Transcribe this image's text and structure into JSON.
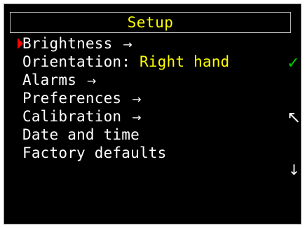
{
  "screen": {
    "title": "Setup"
  },
  "menu": {
    "items": [
      {
        "label": "Brightness",
        "suffix": "→",
        "value": "",
        "selected": true
      },
      {
        "label": "Orientation:",
        "suffix": "",
        "value": "Right hand",
        "selected": false
      },
      {
        "label": "Alarms",
        "suffix": "→",
        "value": "",
        "selected": false
      },
      {
        "label": "Preferences",
        "suffix": "→",
        "value": "",
        "selected": false
      },
      {
        "label": "Calibration",
        "suffix": "→",
        "value": "",
        "selected": false
      },
      {
        "label": "Date and time",
        "suffix": "",
        "value": "",
        "selected": false
      },
      {
        "label": "Factory defaults",
        "suffix": "",
        "value": "",
        "selected": false
      }
    ]
  },
  "side_buttons": {
    "ok_icon": "check-icon",
    "up_icon": "arrow-up-left-icon",
    "down_icon": "arrow-down-icon",
    "ok_glyph": "✓",
    "up_glyph": "↖",
    "down_glyph": "↓"
  },
  "colors": {
    "background": "#000000",
    "text": "#ffffff",
    "accent": "#ffff00",
    "selection": "#ff0000",
    "ok": "#00cc00"
  }
}
